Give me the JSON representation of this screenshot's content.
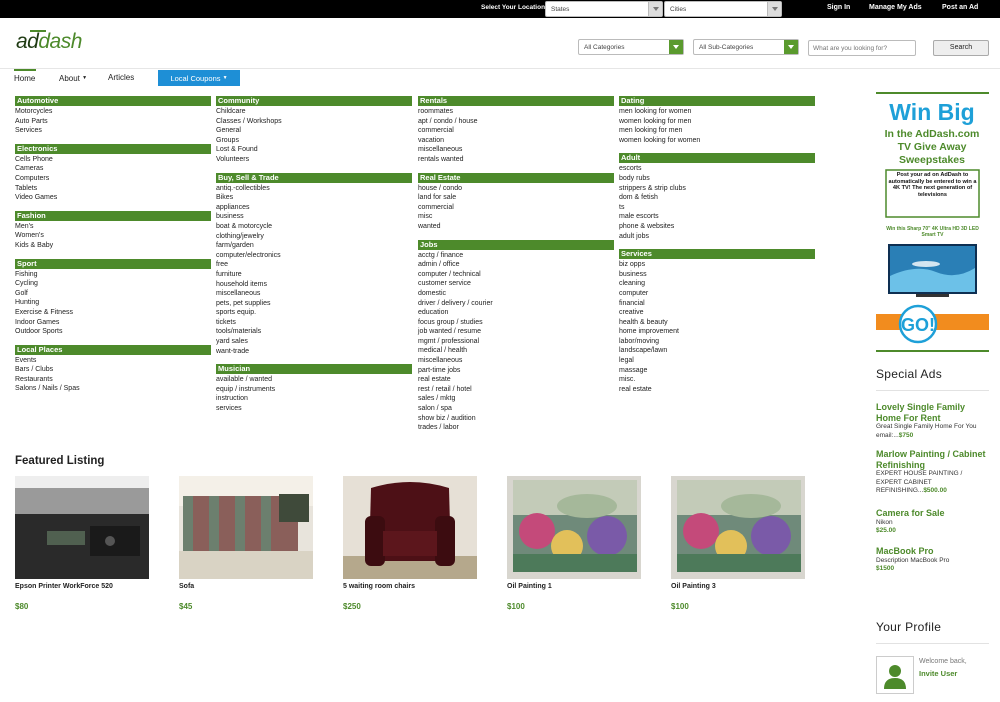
{
  "topbar": {
    "location_label": "Select Your Location",
    "states_select": "States",
    "cities_select": "Cities",
    "sign_in": "Sign In",
    "manage_ads": "Manage My Ads",
    "post_ad": "Post an Ad"
  },
  "header": {
    "logo_ad": "ad",
    "logo_dash": "dash",
    "categories_select": "All Categories",
    "subcategories_select": "All Sub-Categories",
    "search_placeholder": "What are you looking for?",
    "search_button": "Search"
  },
  "nav": {
    "home": "Home",
    "about": "About",
    "articles": "Articles",
    "coupons": "Local Coupons"
  },
  "categories": {
    "col1": [
      {
        "title": "Automotive",
        "items": [
          "Motorcycles",
          "Auto Parts",
          "Services"
        ]
      },
      {
        "title": "Electronics",
        "items": [
          "Cells Phone",
          "Cameras",
          "Computers",
          "Tablets",
          "Video Games"
        ]
      },
      {
        "title": "Fashion",
        "items": [
          "Men's",
          "Women's",
          "Kids & Baby"
        ]
      },
      {
        "title": "Sport",
        "items": [
          "Fishing",
          "Cycling",
          "Golf",
          "Hunting",
          "Exercise & Fitness",
          "Indoor Games",
          "Outdoor Sports"
        ]
      },
      {
        "title": "Local Places",
        "items": [
          "Events",
          "Bars / Clubs",
          "Restaurants",
          "Salons / Nails / Spas"
        ]
      }
    ],
    "col2": [
      {
        "title": "Community",
        "items": [
          "Childcare",
          "Classes / Workshops",
          "General",
          "Groups",
          "Lost & Found",
          "Volunteers"
        ]
      },
      {
        "title": "Buy, Sell & Trade",
        "items": [
          "antiq.-collectibles",
          "Bikes",
          "appliances",
          "business",
          "boat & motorcycle",
          "clothing/jewelry",
          "farm/garden",
          "computer/electronics",
          "free",
          "furniture",
          "household items",
          "miscellaneous",
          "pets, pet supplies",
          "sports equip.",
          "tickets",
          "tools/materials",
          "yard sales",
          "want-trade"
        ]
      },
      {
        "title": "Musician",
        "items": [
          "available / wanted",
          "equip / instruments",
          "instruction",
          "services"
        ]
      }
    ],
    "col3": [
      {
        "title": "Rentals",
        "items": [
          "roommates",
          "apt / condo / house",
          "commercial",
          "vacation",
          "miscellaneous",
          "rentals wanted"
        ]
      },
      {
        "title": "Real Estate",
        "items": [
          "house / condo",
          "land for sale",
          "commercial",
          "misc",
          "wanted"
        ]
      },
      {
        "title": "Jobs",
        "items": [
          "acctg / finance",
          "admin / office",
          "computer / technical",
          "customer service",
          "domestic",
          "driver / delivery / courier",
          "education",
          "focus group / studies",
          "job wanted / resume",
          "mgmt / professional",
          "medical / health",
          "miscellaneous",
          "part-time jobs",
          "real estate",
          "rest / retail / hotel",
          "sales / mktg",
          "salon / spa",
          "show biz / audition",
          "trades / labor"
        ]
      }
    ],
    "col4": [
      {
        "title": "Dating",
        "items": [
          "men looking for women",
          "women looking for men",
          "men looking for men",
          "women looking for women"
        ]
      },
      {
        "title": "Adult",
        "items": [
          "escorts",
          "body rubs",
          "strippers & strip clubs",
          "dom & fetish",
          "ts",
          "male escorts",
          "phone & websites",
          "adult jobs"
        ]
      },
      {
        "title": "Services",
        "items": [
          "biz opps",
          "business",
          "cleaning",
          "computer",
          "financial",
          "creative",
          "health & beauty",
          "home improvement",
          "labor/moving",
          "landscape/lawn",
          "legal",
          "massage",
          "misc.",
          "real estate"
        ]
      }
    ]
  },
  "featured": {
    "title": "Featured Listing",
    "listings": [
      {
        "name": "Epson Printer WorkForce 520",
        "price": "$80",
        "image": "printer"
      },
      {
        "name": "Sofa",
        "price": "$45",
        "image": "sofa"
      },
      {
        "name": "5 waiting room chairs",
        "price": "$250",
        "image": "chair"
      },
      {
        "name": "Oil Painting 1",
        "price": "$100",
        "image": "painting"
      },
      {
        "name": "Oil Painting 3",
        "price": "$100",
        "image": "painting"
      }
    ]
  },
  "sidebar": {
    "banner": {
      "headline": "Win Big",
      "line1": "In the AdDash.com",
      "line2": "TV Give Away",
      "line3": "Sweepstakes",
      "box": "Post your ad on AdDash to automatically be entered to win a 4K TV! The next generation of televisions",
      "tv_caption": "Win this Sharp 70\" 4K Ultra HD 3D LED Smart TV",
      "go": "GO!"
    },
    "special_title": "Special Ads",
    "special_ads": [
      {
        "title": "Lovely Single Family Home For Rent",
        "desc": "Great Single Family Home For You email:...",
        "price": "$750"
      },
      {
        "title": "Marlow Painting / Cabinet Refinishing",
        "desc": "EXPERT HOUSE PAINTING / EXPERT CABINET REFINISHING...",
        "price": "$500.00"
      },
      {
        "title": "Camera for Sale",
        "desc": "Nikon",
        "price": "$25.00"
      },
      {
        "title": "MacBook Pro",
        "desc": "Description MacBook Pro",
        "price": "$1500"
      }
    ],
    "profile_title": "Your Profile",
    "welcome": "Welcome back,",
    "invite": "Invite User"
  },
  "colors": {
    "brand_green": "#4d8a2b",
    "coupon_blue": "#1e8fd6"
  }
}
